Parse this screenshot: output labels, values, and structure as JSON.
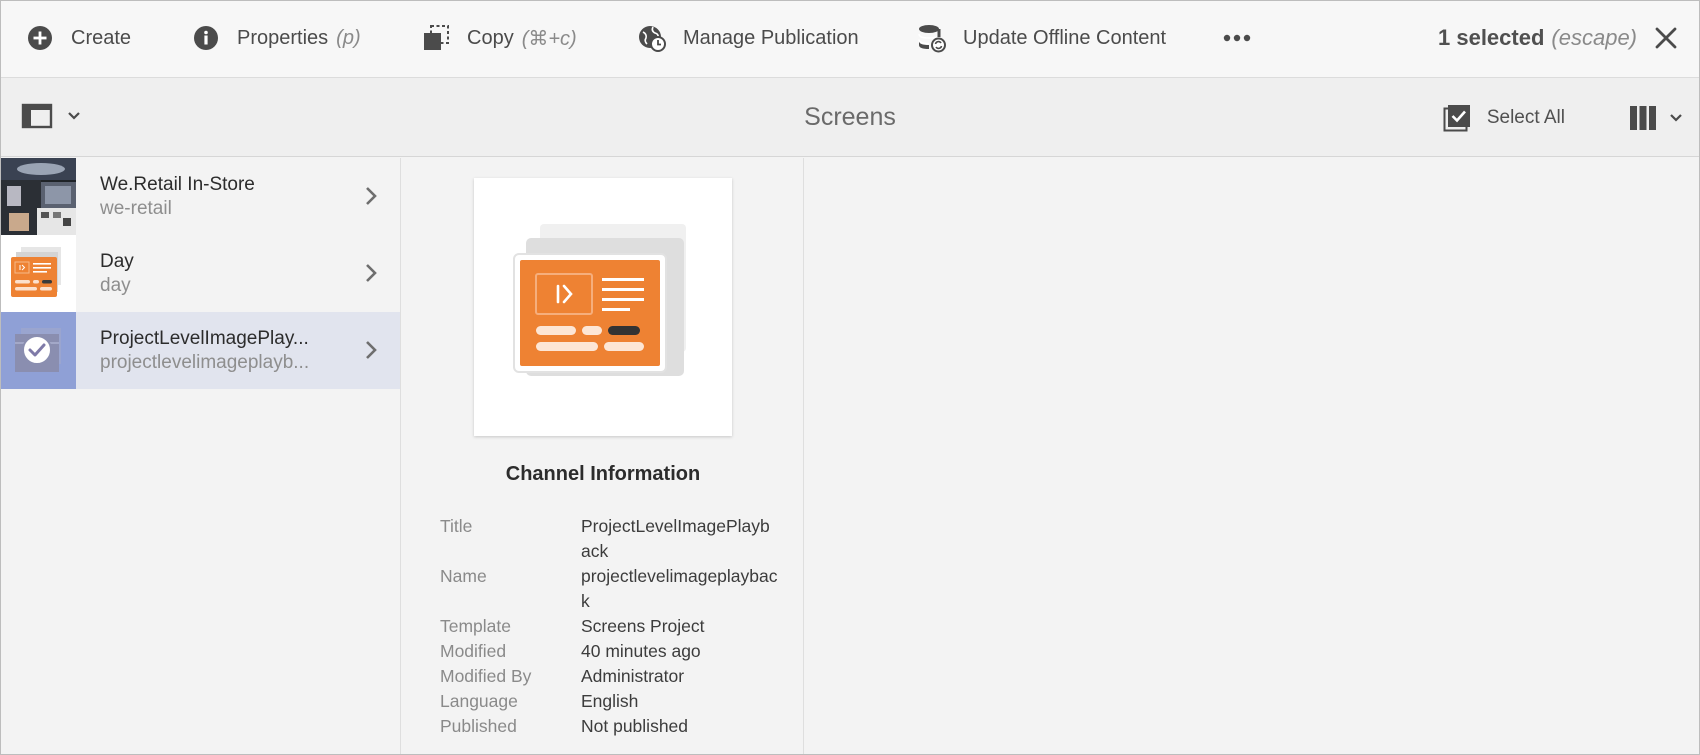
{
  "actionbar": {
    "create": {
      "label": "Create"
    },
    "properties": {
      "label": "Properties",
      "hint": "(p)"
    },
    "copy": {
      "label": "Copy",
      "hint": "(⌘+c)"
    },
    "manage_publication": {
      "label": "Manage Publication"
    },
    "update_offline": {
      "label": "Update Offline Content"
    },
    "more_icon": "ellipsis-icon",
    "selection": {
      "count_text": "1 selected",
      "escape_hint": "(escape)"
    }
  },
  "titlebar": {
    "title": "Screens",
    "select_all": "Select All",
    "rail_icon": "rail-toggle-icon",
    "view_icon": "column-view-icon"
  },
  "columns": {
    "first": [
      {
        "title": "We.Retail In-Store",
        "name": "we-retail",
        "thumb": "photo-collage"
      },
      {
        "title": "Day",
        "name": "day",
        "thumb": "channel-icon"
      },
      {
        "title": "ProjectLevelImagePlay...",
        "name": "projectlevelimageplayb...",
        "thumb": "checked-channel",
        "selected": true
      }
    ]
  },
  "preview": {
    "heading": "Channel Information",
    "meta": [
      {
        "key": "Title",
        "value": "ProjectLevelImagePlayback"
      },
      {
        "key": "Name",
        "value": "projectlevelimageplayback"
      },
      {
        "key": "Template",
        "value": "Screens Project"
      },
      {
        "key": "Modified",
        "value": "40 minutes ago"
      },
      {
        "key": "Modified By",
        "value": "Administrator"
      },
      {
        "key": "Language",
        "value": "English"
      },
      {
        "key": "Published",
        "value": "Not published"
      }
    ]
  },
  "colors": {
    "accent_orange": "#ee8233",
    "selected_row": "#e1e4ee",
    "selected_thumb": "#8fa0d6"
  }
}
